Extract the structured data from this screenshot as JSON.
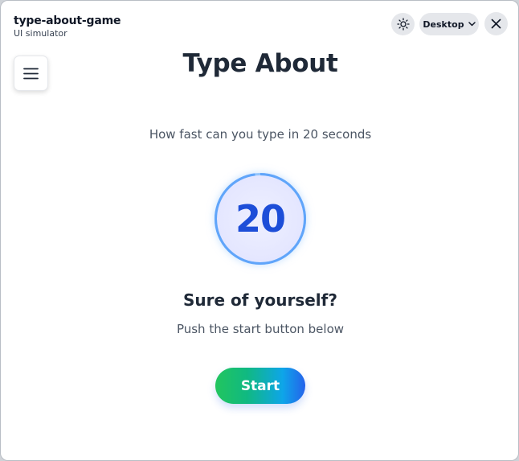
{
  "window": {
    "title": "type-about-game",
    "subtitle": "UI simulator",
    "device_selector": {
      "selected": "Desktop",
      "icon": "chevron-down-icon"
    },
    "theme_toggle_icon": "sun-icon",
    "close_icon": "close-icon"
  },
  "game": {
    "menu_icon": "hamburger-menu-icon",
    "title": "Type About",
    "tagline": "How fast can you type in 20 seconds",
    "timer": {
      "value": "20",
      "remaining_fraction": 0.98
    },
    "prompt_heading": "Sure of yourself?",
    "prompt_text": "Push the start button below",
    "start_label": "Start"
  },
  "colors": {
    "accent_blue": "#1d4ed8",
    "ring": "#93c5fd",
    "start_gradient_from": "#22c55e",
    "start_gradient_to": "#2563eb",
    "title_text": "#1f2937"
  }
}
